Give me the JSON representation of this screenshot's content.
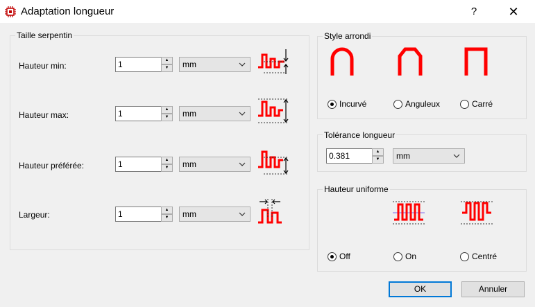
{
  "window": {
    "title": "Adaptation longueur",
    "help_label": "?",
    "close_label": "✕",
    "icon": "chip-icon"
  },
  "serpentine_group": {
    "title": "Taille serpentin",
    "rows": [
      {
        "name": "hauteur-min",
        "label": "Hauteur min:",
        "value": "1",
        "unit": "mm",
        "illustration": "height-min-icon"
      },
      {
        "name": "hauteur-max",
        "label": "Hauteur max:",
        "value": "1",
        "unit": "mm",
        "illustration": "height-max-icon"
      },
      {
        "name": "hauteur-preferee",
        "label": "Hauteur préférée:",
        "value": "1",
        "unit": "mm",
        "illustration": "height-preferred-icon"
      },
      {
        "name": "largeur",
        "label": "Largeur:",
        "value": "1",
        "unit": "mm",
        "illustration": "width-icon"
      }
    ]
  },
  "style_group": {
    "title": "Style arrondi",
    "options": [
      {
        "label": "Incurvé",
        "selected": true,
        "icon": "curved-style-icon"
      },
      {
        "label": "Anguleux",
        "selected": false,
        "icon": "angled-style-icon"
      },
      {
        "label": "Carré",
        "selected": false,
        "icon": "square-style-icon"
      }
    ]
  },
  "tolerance_group": {
    "title": "Tolérance longueur",
    "value": "0.381",
    "unit": "mm"
  },
  "uniform_group": {
    "title": "Hauteur uniforme",
    "options": [
      {
        "label": "Off",
        "selected": true
      },
      {
        "label": "On",
        "selected": false
      },
      {
        "label": "Centré",
        "selected": false
      }
    ]
  },
  "buttons": {
    "ok": "OK",
    "cancel": "Annuler"
  },
  "colors": {
    "trace": "#ff0000",
    "accent": "#0078d7"
  }
}
